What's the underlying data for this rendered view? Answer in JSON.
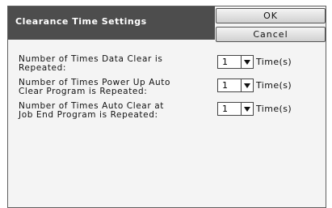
{
  "dialog": {
    "title": "Clearance Time Settings",
    "ok_label": "OK",
    "cancel_label": "Cancel"
  },
  "rows": [
    {
      "label_line1": "Number of Times Data Clear is",
      "label_line2": "Repeated:",
      "value": "1",
      "unit": "Time(s)"
    },
    {
      "label_line1": "Number of Times Power Up Auto",
      "label_line2": "Clear Program is Repeated:",
      "value": "1",
      "unit": "Time(s)"
    },
    {
      "label_line1": "Number of Times Auto Clear at",
      "label_line2": "Job End Program is Repeated:",
      "value": "1",
      "unit": "Time(s)"
    }
  ],
  "icons": {
    "dropdown": "chevron-down-icon"
  },
  "colors": {
    "title_bg": "#4d4d4d",
    "panel_bg": "#f4f4f4",
    "button_border": "#555555"
  }
}
